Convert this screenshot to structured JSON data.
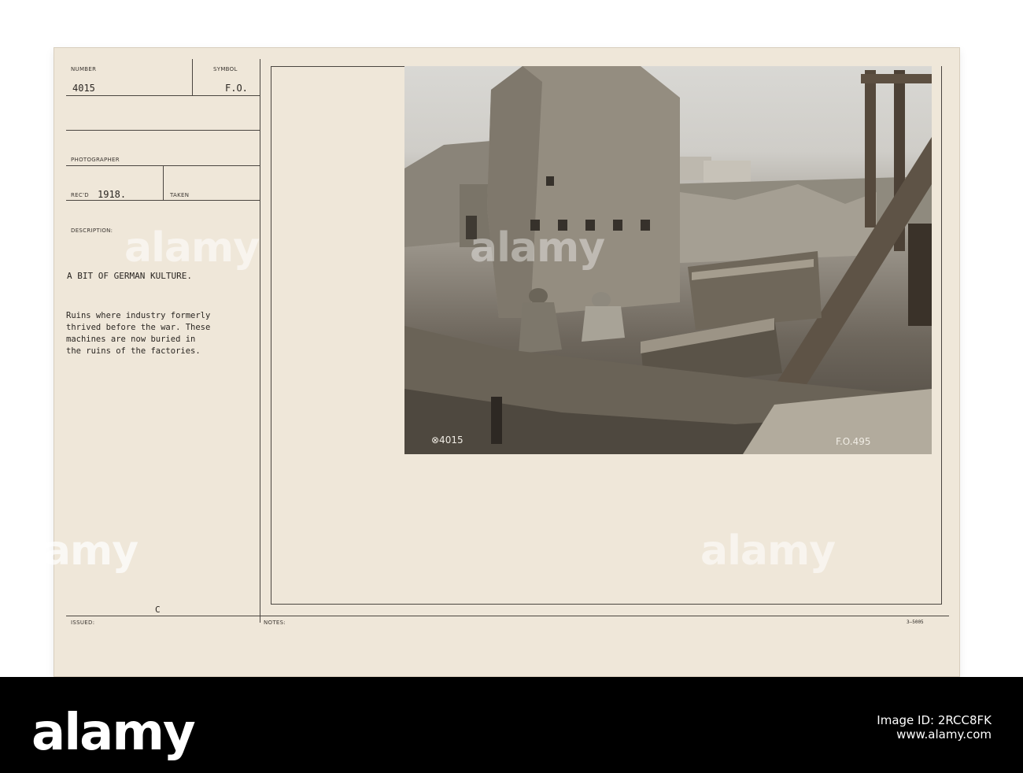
{
  "card": {
    "labels": {
      "number": "NUMBER",
      "symbol": "SYMBOL",
      "photographer": "PHOTOGRAPHER",
      "recd": "REC'D",
      "taken": "TAKEN",
      "description": "DESCRIPTION:",
      "issued": "ISSUED:",
      "notes": "NOTES:"
    },
    "number_value": "4015",
    "symbol_value": "F.O.",
    "recd_value": "1918.",
    "title": "A BIT OF GERMAN KULTURE.",
    "description_lines": [
      "Ruins where industry formerly",
      "thrived before the war. These",
      "machines are now buried in",
      "the ruins of the factories."
    ],
    "issued_mark": "C",
    "form_number": "3—5005"
  },
  "photo": {
    "caption_left": "⊗4015",
    "caption_right": "F.O.495"
  },
  "watermark": "alamy",
  "footer": {
    "logo": "alamy",
    "image_id_label": "Image ID: 2RCC8FK",
    "site": "www.alamy.com"
  },
  "colors": {
    "card": "#efe7d9",
    "footer": "#000000"
  }
}
